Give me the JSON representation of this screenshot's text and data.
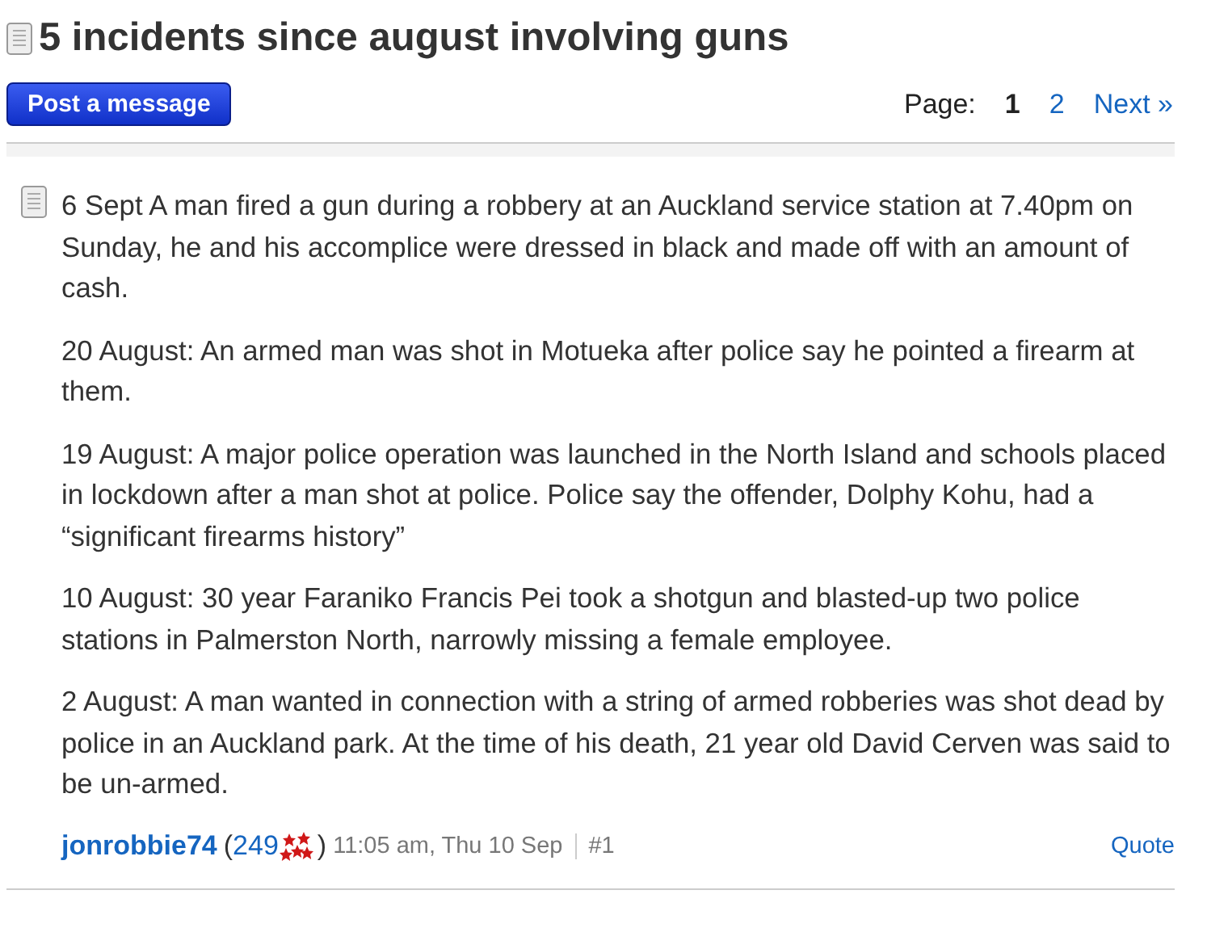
{
  "thread": {
    "title": "5 incidents since august involving guns"
  },
  "post_button": "Post a message",
  "pagination": {
    "label": "Page:",
    "pages": [
      {
        "label": "1",
        "selected": true
      },
      {
        "label": "2",
        "selected": false
      }
    ],
    "next": "Next »"
  },
  "post": {
    "paragraphs": [
      "6 Sept A man fired a gun during a robbery at an Auckland service station at 7.40pm on Sunday, he and his accomplice were dressed in black and made off with an amount of cash.",
      "20 August: An armed man was shot in Motueka after police say he pointed a firearm at them.",
      "19 August: A major police operation was launched in the North Island and schools placed in lockdown after a man shot at police. Police say the offender, Dolphy Kohu, had a “significant firearms history”",
      "10 August: 30 year Faraniko Francis Pei took a shotgun and blasted-up two police stations in Palmerston North, narrowly missing a female employee.",
      "2 August: A man wanted in connection with a string of armed robberies was shot dead by police in an Auckland park. At the time of his death, 21 year old David Cerven was said to be un-armed."
    ],
    "author": "jonrobbie74",
    "open_paren": "(",
    "karma": "249",
    "close_paren": ")",
    "time": "11:05 am, Thu 10 Sep",
    "number": "#1",
    "quote": "Quote"
  }
}
